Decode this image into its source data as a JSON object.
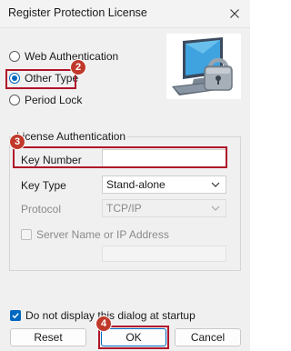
{
  "window": {
    "title": "Register Protection License"
  },
  "auth_options": [
    {
      "label": "Web Authentication",
      "checked": false
    },
    {
      "label": "Other Type",
      "checked": true
    },
    {
      "label": "Period Lock",
      "checked": false
    }
  ],
  "license_group": {
    "title": "License Authentication",
    "key_number": {
      "label": "Key Number",
      "value": ""
    },
    "key_type": {
      "label": "Key Type",
      "value": "Stand-alone"
    },
    "protocol": {
      "label": "Protocol",
      "value": "TCP/IP"
    },
    "server": {
      "label": "Server Name or IP Address",
      "value": ""
    }
  },
  "startup_checkbox": {
    "label": "Do not display this dialog at startup",
    "checked": true
  },
  "buttons": {
    "reset": "Reset",
    "ok": "OK",
    "cancel": "Cancel"
  },
  "badges": [
    "2",
    "3",
    "4"
  ],
  "colors": {
    "accent": "#0067c0",
    "highlight": "#b0142a",
    "badge": "#c0392b"
  },
  "icons": {
    "close": "close-icon",
    "lock": "computer-lock-icon",
    "dropdown": "chevron-down-icon"
  }
}
